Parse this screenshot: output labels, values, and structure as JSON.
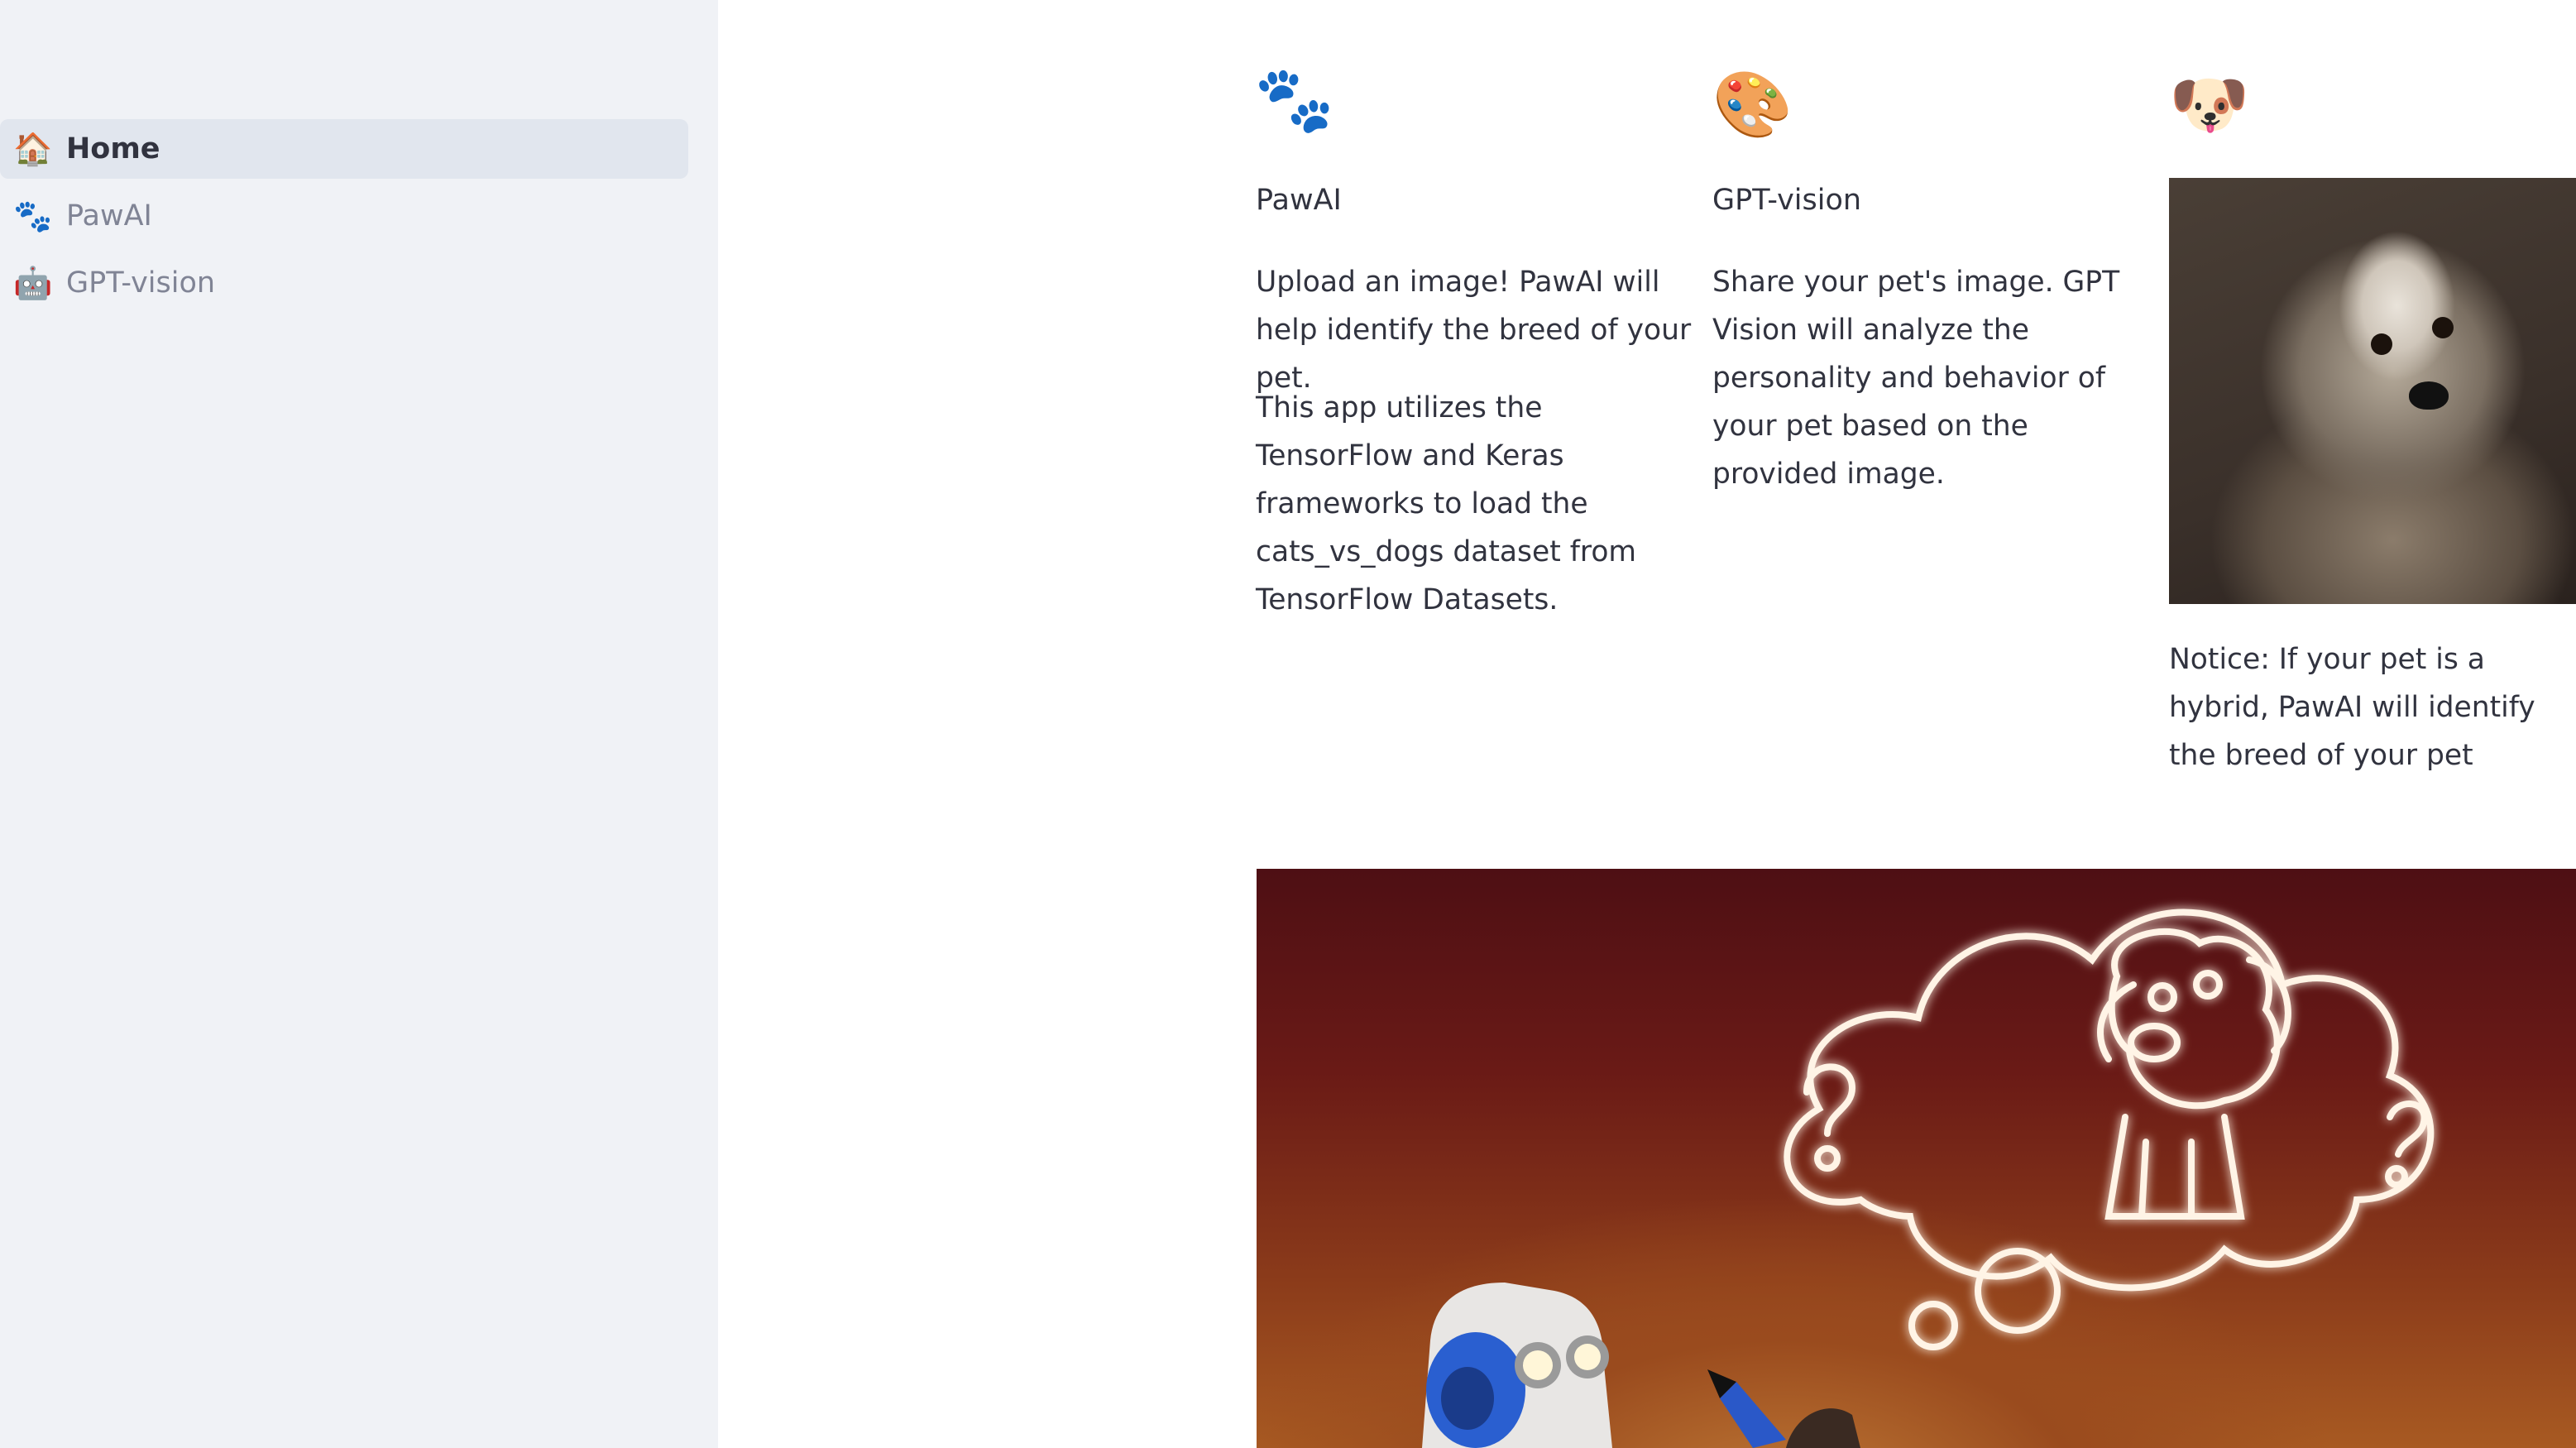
{
  "sidebar": {
    "items": [
      {
        "icon": "house-icon",
        "emoji": "🏠",
        "label": "Home",
        "active": true
      },
      {
        "icon": "paw-prints-icon",
        "emoji": "🐾",
        "label": "PawAI",
        "active": false
      },
      {
        "icon": "robot-icon",
        "emoji": "🤖",
        "label": "GPT-vision",
        "active": false
      }
    ]
  },
  "main": {
    "columns": [
      {
        "icon": "paw-prints-icon",
        "emoji": "🐾",
        "title": "PawAI",
        "paragraphs": [
          "Upload an image! PawAI will help identify the breed of your pet.",
          "This app utilizes the TensorFlow and Keras frameworks to load the cats_vs_dogs dataset from TensorFlow Datasets."
        ]
      },
      {
        "icon": "artist-palette-icon",
        "emoji": "🎨",
        "title": "GPT-vision",
        "paragraphs": [
          "Share your pet's image. GPT Vision will analyze the personality and behavior of your pet based on the provided image."
        ]
      },
      {
        "icon": "dog-face-icon",
        "emoji": "🐶",
        "notice": "Notice: If your pet is a hybrid, PawAI will identify the breed of your pet"
      }
    ]
  },
  "colors": {
    "sidebar_bg": "#f0f2f6",
    "active_item_bg": "#e1e6ee",
    "text": "#31333f",
    "muted_text": "#808495"
  }
}
